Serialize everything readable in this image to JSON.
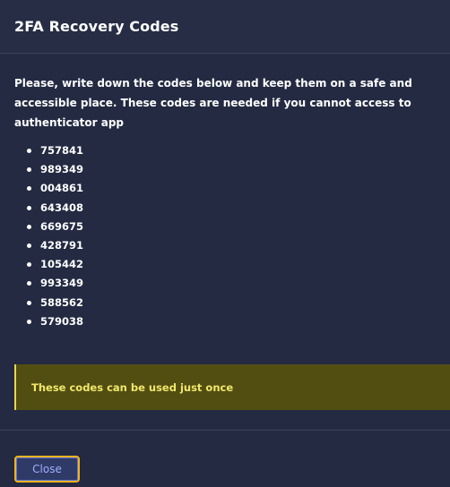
{
  "modal": {
    "title": "2FA Recovery Codes",
    "instructions": "Please, write down the codes below and keep them on a safe and accessible place. These codes are needed if you cannot access to authenticator app",
    "codes": [
      "757841",
      "989349",
      "004861",
      "643408",
      "669675",
      "428791",
      "105442",
      "993349",
      "588562",
      "579038"
    ],
    "alert": {
      "text": "These codes can be used just once"
    },
    "footer": {
      "close_label": "Close"
    }
  },
  "colors": {
    "background": "#232a42",
    "text": "#ffffff",
    "alert_background": "#524e12",
    "alert_text": "#f1e86c",
    "alert_border": "#e8d64e",
    "button_border": "#f5b31c",
    "button_text": "#9fb0ff"
  }
}
